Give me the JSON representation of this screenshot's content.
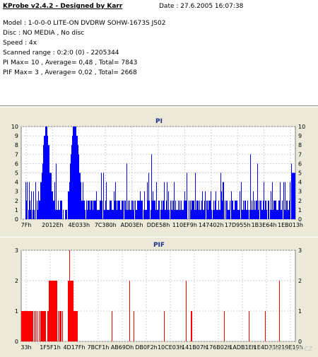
{
  "info": {
    "title": "KProbe v2.4.2 - Designed by Karr",
    "date": "Date : 27.6.2005 16:07:38",
    "lines": [
      "Model : 1-0-0-0 LITE-ON DVDRW SOHW-1673S JS02",
      "Disc : NO MEDIA , No disc",
      "Speed : 4x",
      "Scanned range : 0:2:0 (0) - 2205344",
      "PI Max= 10 , Average= 0,48 , Total= 7843",
      "PIF Max= 3 , Average= 0,02 , Total= 2668"
    ]
  },
  "pi_chart": {
    "title": "PI",
    "color": "#0000ff",
    "ylim": [
      0,
      10
    ],
    "yticks": [
      "0",
      "1",
      "2",
      "3",
      "4",
      "5",
      "6",
      "7",
      "8",
      "9",
      "10"
    ],
    "xticks": [
      "7Fh",
      "2012Eh",
      "4E033h",
      "7C380h",
      "AD03Eh",
      "DDE58h",
      "110EF9h",
      "147402h",
      "17D955h",
      "1B3E64h",
      "1EB013h"
    ]
  },
  "pif_chart": {
    "title": "PIF",
    "color": "#ff0000",
    "ylim": [
      0,
      3
    ],
    "yticks": [
      "0",
      "1",
      "2",
      "3"
    ],
    "xticks": [
      "33h",
      "1F5F1h",
      "4D17Fh",
      "7BCF1h",
      "AB69Dh",
      "DB0F2h",
      "10CE03h",
      "141B07h",
      "176B02h",
      "1ADB1Eh",
      "1E4D33h",
      "219E19h"
    ]
  },
  "chart_data": [
    {
      "type": "bar",
      "title": "PI",
      "ylim": [
        0,
        10
      ],
      "max": 10,
      "average": 0.48,
      "total": 7843
    },
    {
      "type": "bar",
      "title": "PIF",
      "ylim": [
        0,
        3
      ],
      "max": 3,
      "average": 0.02,
      "total": 2668
    }
  ],
  "watermark": "www.cdr.cz"
}
